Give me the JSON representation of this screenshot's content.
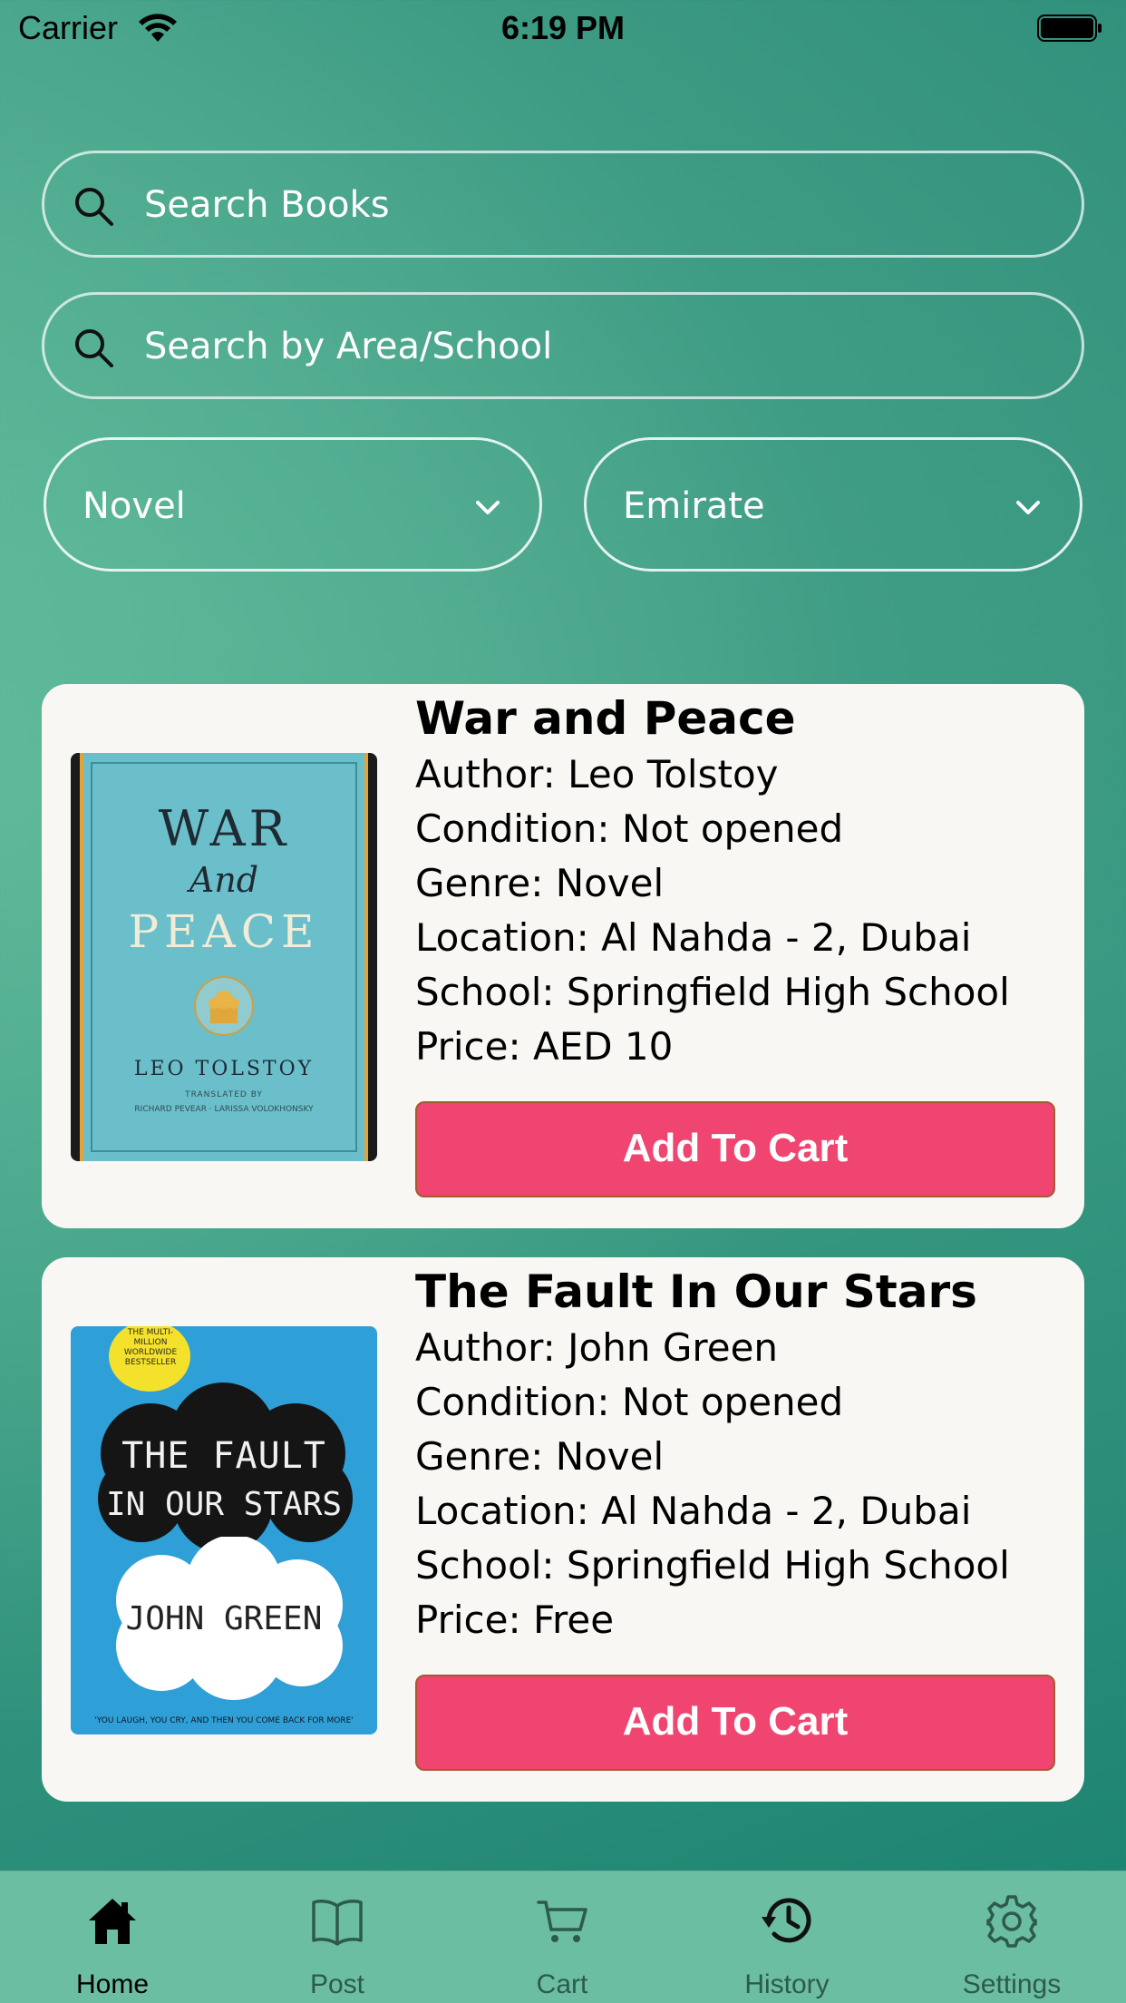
{
  "status_bar": {
    "carrier": "Carrier",
    "time": "6:19 PM"
  },
  "search": {
    "books_placeholder": "Search Books",
    "area_placeholder": "Search by Area/School"
  },
  "filters": {
    "genre_selected": "Novel",
    "emirate_selected": "Emirate"
  },
  "books": [
    {
      "title": "War and Peace",
      "author": "Author: Leo Tolstoy",
      "condition": "Condition: Not opened",
      "genre": "Genre: Novel",
      "location": "Location: Al Nahda - 2, Dubai",
      "school": "School: Springfield High School",
      "price": "Price: AED 10",
      "button": "Add To Cart",
      "cover": {
        "line1": "WAR",
        "line2": "And",
        "line3": "PEACE",
        "author": "LEO TOLSTOY",
        "translated": "TRANSLATED BY",
        "translators": "RICHARD PEVEAR · LARISSA VOLOKHONSKY"
      }
    },
    {
      "title": "The Fault In Our Stars",
      "author": "Author: John Green",
      "condition": "Condition: Not opened",
      "genre": "Genre: Novel",
      "location": "Location: Al Nahda - 2, Dubai",
      "school": "School: Springfield High School",
      "price": "Price: Free",
      "button": "Add To Cart",
      "cover": {
        "badge": "THE MULTI-MILLION WORLDWIDE BESTSELLER",
        "line1": "THE FAULT",
        "line2": "IN OUR STARS",
        "author": "JOHN GREEN",
        "tagline": "'YOU LAUGH, YOU CRY, AND THEN YOU COME BACK FOR MORE'"
      }
    }
  ],
  "tabs": [
    {
      "label": "Home",
      "icon": "home-icon",
      "active": true
    },
    {
      "label": "Post",
      "icon": "book-icon",
      "active": false
    },
    {
      "label": "Cart",
      "icon": "cart-icon",
      "active": false
    },
    {
      "label": "History",
      "icon": "history-icon",
      "active": false
    },
    {
      "label": "Settings",
      "icon": "gear-icon",
      "active": false
    }
  ],
  "colors": {
    "accent_button": "#ef4570",
    "tabbar": "#6bbea2",
    "card": "#f8f7f4"
  }
}
